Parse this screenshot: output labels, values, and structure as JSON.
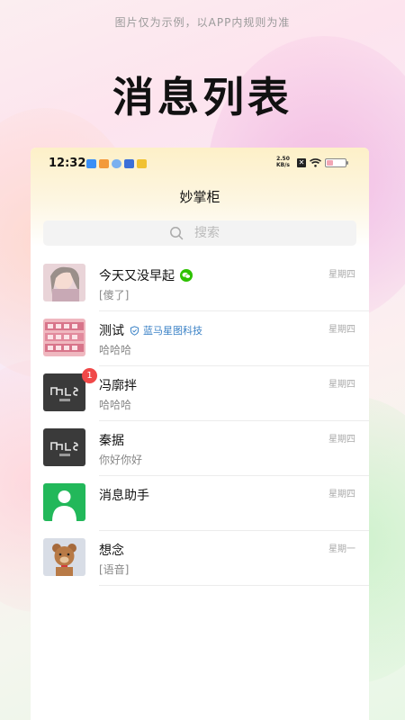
{
  "promo": {
    "disclaimer": "图片仅为示例，以APP内规则为准",
    "headline": "消息列表"
  },
  "status_bar": {
    "time": "12:32",
    "net_speed_value": "2.50",
    "net_speed_unit": "KB/s",
    "battery_level_percent": 30,
    "icons": [
      "mail-app-icon",
      "shop-app-icon",
      "cloud-app-icon",
      "gallery-app-icon",
      "folder-app-icon",
      "sim-off-icon",
      "wifi-icon",
      "battery-icon"
    ]
  },
  "app": {
    "title": "妙掌柜",
    "search_placeholder": "搜索"
  },
  "conversations": [
    {
      "name": "今天又没早起",
      "preview": "[傻了]",
      "date": "星期四",
      "wechat": true,
      "org": "",
      "badge": ""
    },
    {
      "name": "测试",
      "preview": "哈哈哈",
      "date": "星期四",
      "wechat": false,
      "org": "蓝马星图科技",
      "badge": ""
    },
    {
      "name": "冯廓拌",
      "preview": "哈哈哈",
      "date": "星期四",
      "wechat": false,
      "org": "",
      "badge": "1"
    },
    {
      "name": "秦据",
      "preview": "你好你好",
      "date": "星期四",
      "wechat": false,
      "org": "",
      "badge": ""
    },
    {
      "name": "消息助手",
      "preview": "",
      "date": "星期四",
      "wechat": false,
      "org": "",
      "badge": ""
    },
    {
      "name": "想念",
      "preview": "[语音]",
      "date": "星期一",
      "wechat": false,
      "org": "",
      "badge": ""
    }
  ],
  "colors": {
    "badge": "#f04848",
    "wechat_green": "#2dc100",
    "assistant_green": "#22b85a",
    "org_blue": "#3b82c6"
  }
}
